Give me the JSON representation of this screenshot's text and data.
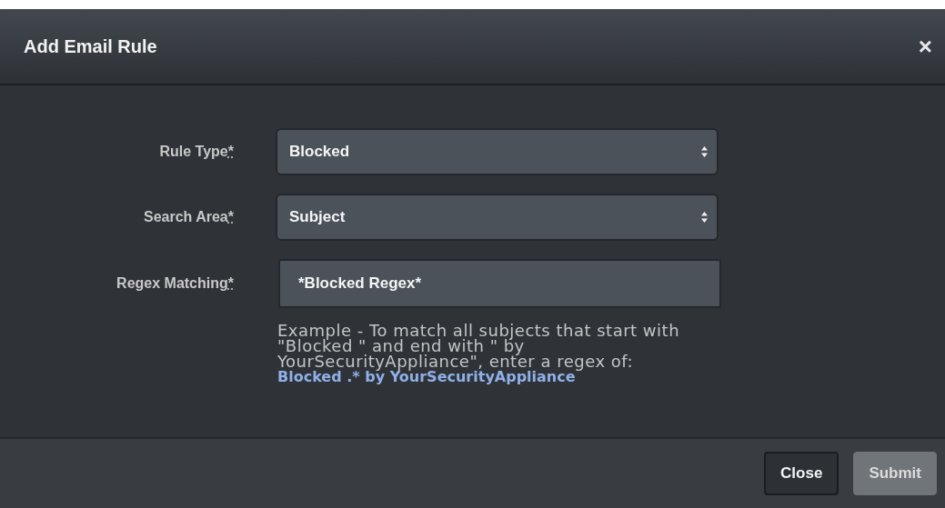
{
  "dialog": {
    "title": "Add Email Rule",
    "close_glyph": "×"
  },
  "fields": [
    {
      "kind": "select",
      "label": "Rule Type",
      "required_mark": "*",
      "value": "Blocked"
    },
    {
      "kind": "select",
      "label": "Search Area",
      "required_mark": "*",
      "value": "Subject"
    },
    {
      "kind": "text",
      "label": "Regex Matching",
      "required_mark": "*",
      "value": "*Blocked Regex*"
    }
  ],
  "help": {
    "text": "Example - To match all subjects that start with \"Blocked \" and end with \" by YourSecurityAppliance\", enter a regex of:",
    "example": "Blocked .* by YourSecurityAppliance"
  },
  "buttons": [
    {
      "label": "Close",
      "kind": "secondary",
      "disabled": false
    },
    {
      "label": "Submit",
      "kind": "primary",
      "disabled": true
    }
  ]
}
